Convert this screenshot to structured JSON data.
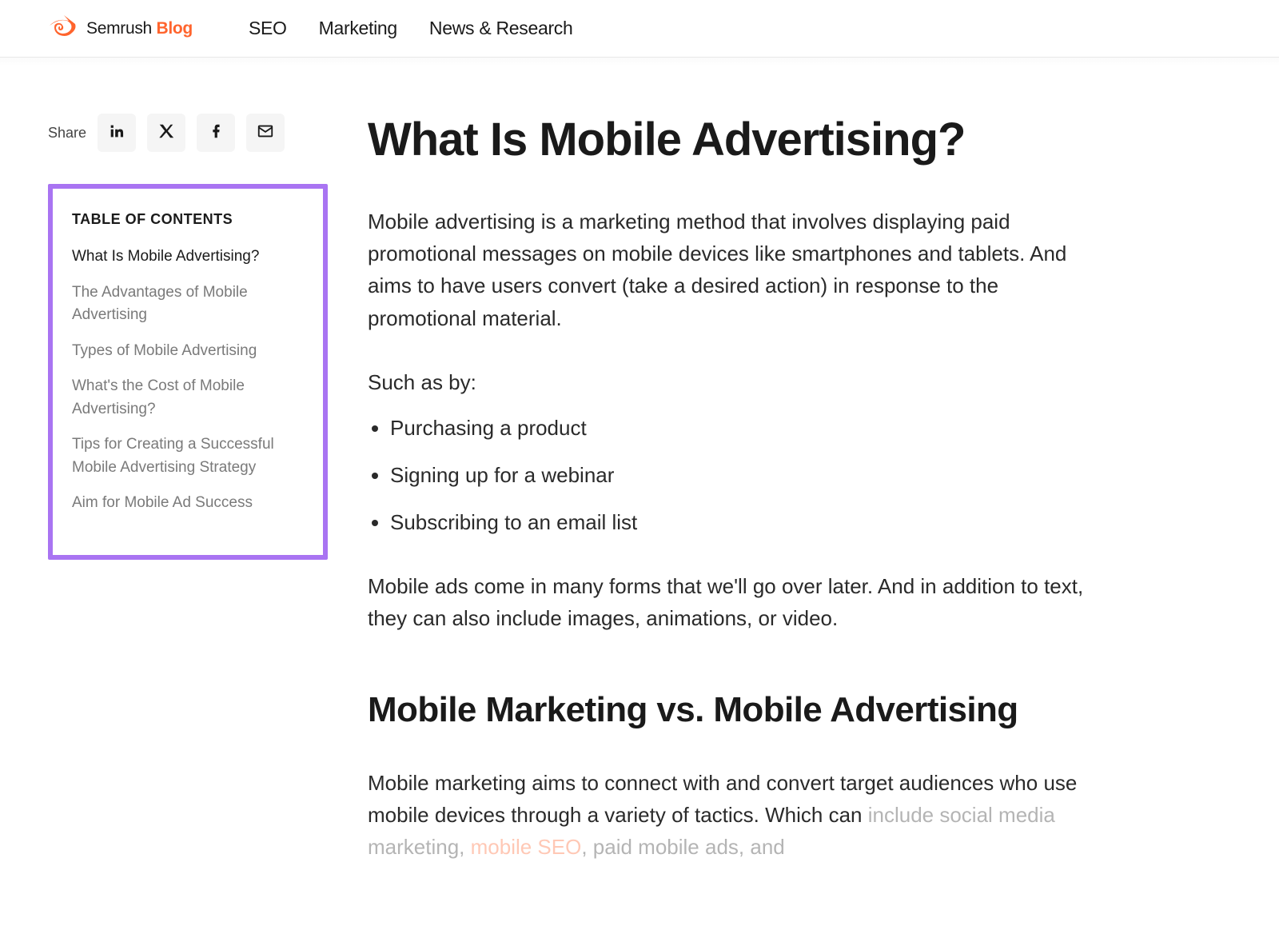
{
  "header": {
    "brand": "Semrush",
    "brand_suffix": "Blog",
    "nav": [
      {
        "label": "SEO"
      },
      {
        "label": "Marketing"
      },
      {
        "label": "News & Research"
      }
    ]
  },
  "sidebar": {
    "share_label": "Share",
    "toc_title": "TABLE OF CONTENTS",
    "toc_items": [
      {
        "label": "What Is Mobile Advertising?",
        "active": true
      },
      {
        "label": "The Advantages of Mobile Advertising",
        "active": false
      },
      {
        "label": "Types of Mobile Advertising",
        "active": false
      },
      {
        "label": "What's the Cost of Mobile Advertising?",
        "active": false
      },
      {
        "label": "Tips for Creating a Successful Mobile Advertising Strategy",
        "active": false
      },
      {
        "label": "Aim for Mobile Ad Success",
        "active": false
      }
    ]
  },
  "article": {
    "h1": "What Is Mobile Advertising?",
    "p1": "Mobile advertising is a marketing method that involves displaying paid promotional messages on mobile devices like smartphones and tablets. And aims to have users convert (take a desired action) in response to the promotional material.",
    "such_as": "Such as by:",
    "bullets": [
      "Purchasing a product",
      "Signing up for a webinar",
      "Subscribing to an email list"
    ],
    "p2": "Mobile ads come in many forms that we'll go over later. And in addition to text, they can also include images, animations, or video.",
    "h2": "Mobile Marketing vs. Mobile Advertising",
    "p3_pre": "Mobile marketing aims to connect with and convert target audiences who use mobile devices through a variety of tactics. Which can ",
    "p3_fade_a": "include social media marketing, ",
    "p3_link": "mobile SEO",
    "p3_fade_b": ", paid mobile ads, and"
  }
}
